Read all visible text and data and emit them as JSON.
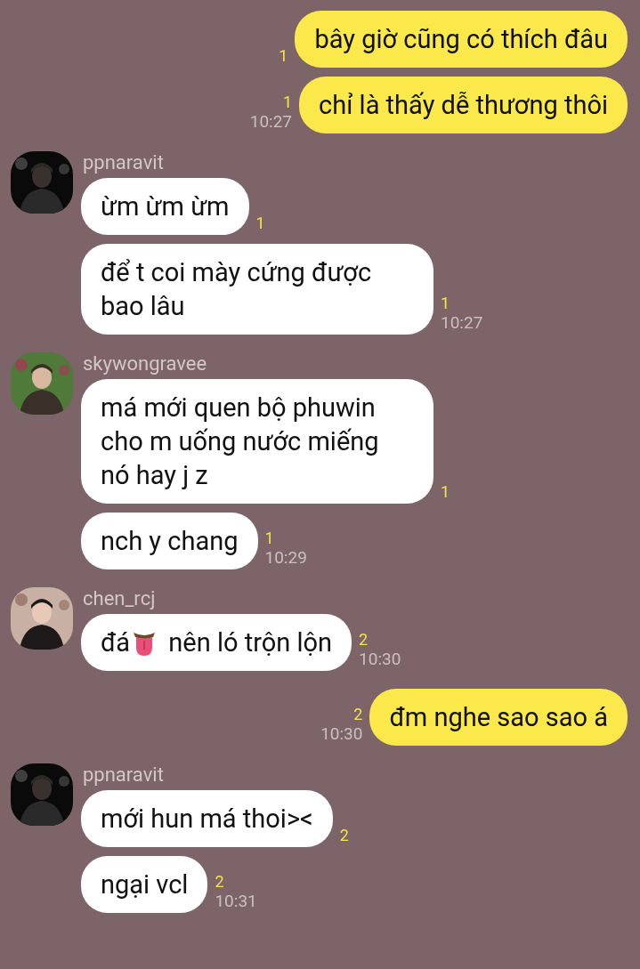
{
  "groups": [
    {
      "kind": "outgoing",
      "messages": [
        {
          "segments": [
            {
              "kind": "text",
              "text": "bây giờ cũng có thích đâu"
            }
          ],
          "read": "1"
        },
        {
          "segments": [
            {
              "kind": "text",
              "text": "chỉ là thấy dễ thương thôi"
            }
          ],
          "read": "1",
          "time": "10:27"
        }
      ]
    },
    {
      "kind": "incoming",
      "name": "ppnaravit",
      "messages": [
        {
          "segments": [
            {
              "kind": "text",
              "text": "ừm ừm ừm"
            }
          ],
          "read": "1"
        },
        {
          "segments": [
            {
              "kind": "text",
              "text": "để t coi mày cứng được bao lâu"
            }
          ],
          "read": "1",
          "time": "10:27"
        }
      ]
    },
    {
      "kind": "incoming",
      "name": "skywongravee",
      "messages": [
        {
          "segments": [
            {
              "kind": "text",
              "text": "má mới quen bộ phuwin cho m uống nước miếng nó hay j z"
            }
          ],
          "read": "1"
        },
        {
          "segments": [
            {
              "kind": "text",
              "text": "nch y chang"
            }
          ],
          "read": "1",
          "time": "10:29"
        }
      ]
    },
    {
      "kind": "incoming",
      "name": "chen_rcj",
      "messages": [
        {
          "segments": [
            {
              "kind": "text",
              "text": "đá"
            },
            {
              "kind": "emoji"
            },
            {
              "kind": "text",
              "text": "nên ló trộn lộn"
            }
          ],
          "read": "2",
          "time": "10:30"
        }
      ]
    },
    {
      "kind": "outgoing",
      "messages": [
        {
          "segments": [
            {
              "kind": "text",
              "text": "đm nghe sao sao á"
            }
          ],
          "read": "2",
          "time": "10:30"
        }
      ]
    },
    {
      "kind": "incoming",
      "name": "ppnaravit",
      "messages": [
        {
          "segments": [
            {
              "kind": "text",
              "text": "mới hun má thoi><"
            }
          ],
          "read": "2"
        },
        {
          "segments": [
            {
              "kind": "text",
              "text": "ngại vcl"
            }
          ],
          "read": "2",
          "time": "10:31"
        }
      ]
    }
  ]
}
